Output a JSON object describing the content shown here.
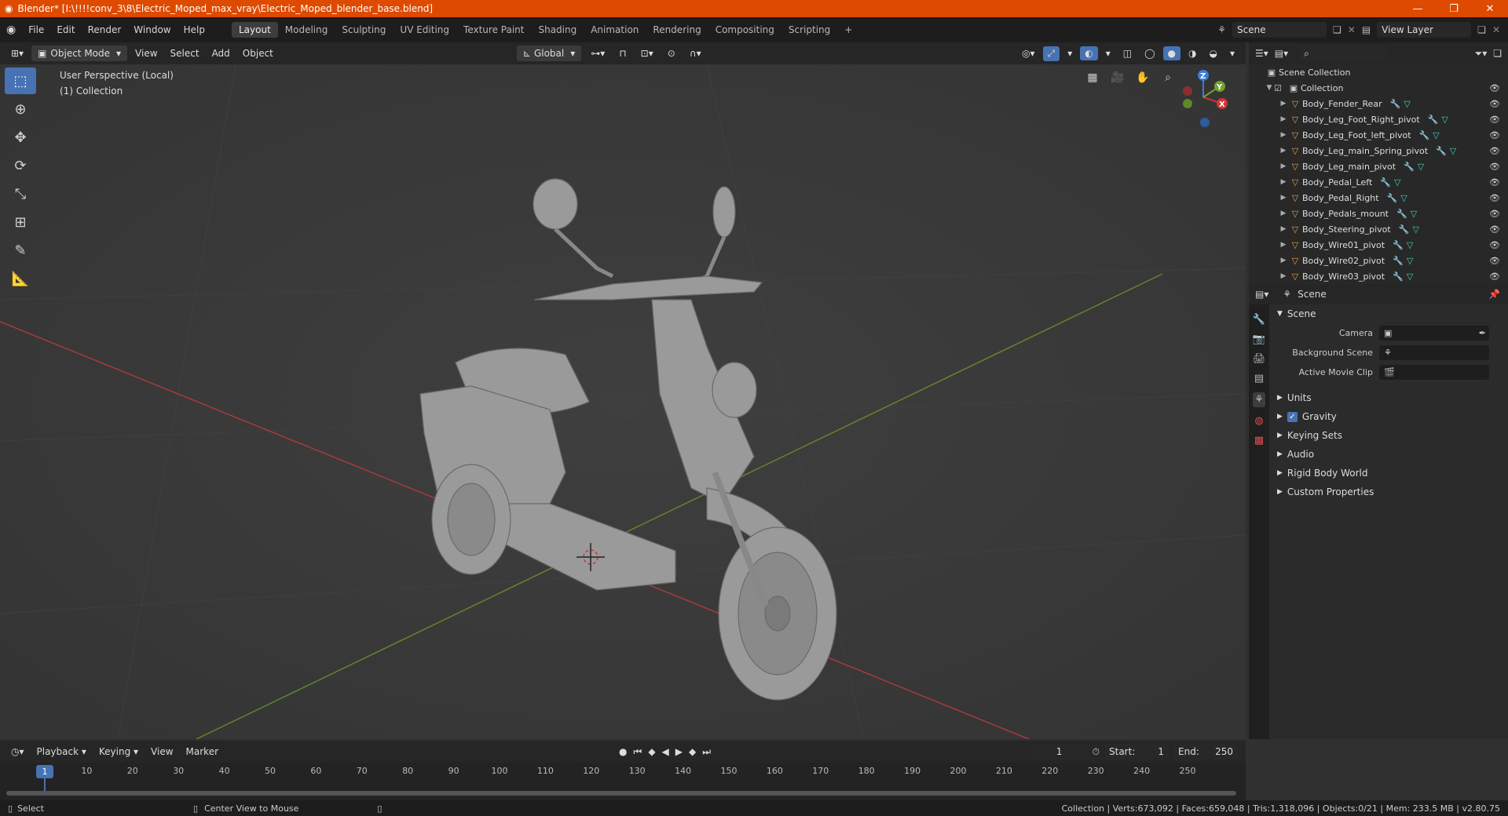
{
  "window": {
    "title": "Blender* [I:\\!!!!conv_3\\8\\Electric_Moped_max_vray\\Electric_Moped_blender_base.blend]",
    "controls": [
      "—",
      "❐",
      "✕"
    ]
  },
  "menu": [
    "File",
    "Edit",
    "Render",
    "Window",
    "Help"
  ],
  "workspaces": [
    {
      "label": "Layout",
      "active": true
    },
    {
      "label": "Modeling"
    },
    {
      "label": "Sculpting"
    },
    {
      "label": "UV Editing"
    },
    {
      "label": "Texture Paint"
    },
    {
      "label": "Shading"
    },
    {
      "label": "Animation"
    },
    {
      "label": "Rendering"
    },
    {
      "label": "Compositing"
    },
    {
      "label": "Scripting"
    }
  ],
  "scene_field": "Scene",
  "view_layer_field": "View Layer",
  "viewport_header": {
    "mode": "Object Mode",
    "menus": [
      "View",
      "Select",
      "Add",
      "Object"
    ],
    "orientation": "Global"
  },
  "viewport": {
    "perspective": "User Perspective (Local)",
    "collection": "(1) Collection"
  },
  "outliner": {
    "root": "Scene Collection",
    "collection": "Collection",
    "items": [
      "Body_Fender_Rear",
      "Body_Leg_Foot_Right_pivot",
      "Body_Leg_Foot_left_pivot",
      "Body_Leg_main_Spring_pivot",
      "Body_Leg_main_pivot",
      "Body_Pedal_Left",
      "Body_Pedal_Right",
      "Body_Pedals_mount",
      "Body_Steering_pivot",
      "Body_Wire01_pivot",
      "Body_Wire02_pivot",
      "Body_Wire03_pivot"
    ]
  },
  "properties": {
    "context": "Scene",
    "panel": "Scene",
    "camera_label": "Camera",
    "background_scene_label": "Background Scene",
    "active_movie_clip_label": "Active Movie Clip",
    "sections": [
      "Units",
      "Gravity",
      "Keying Sets",
      "Audio",
      "Rigid Body World",
      "Custom Properties"
    ]
  },
  "timeline": {
    "menus": [
      "Playback",
      "Keying",
      "View",
      "Marker"
    ],
    "current_frame": "1",
    "start_label": "Start:",
    "start": "1",
    "end_label": "End:",
    "end": "250",
    "ticks": [
      "1",
      "10",
      "20",
      "30",
      "40",
      "50",
      "60",
      "70",
      "80",
      "90",
      "100",
      "110",
      "120",
      "130",
      "140",
      "150",
      "160",
      "170",
      "180",
      "190",
      "200",
      "210",
      "220",
      "230",
      "240",
      "250"
    ]
  },
  "status": {
    "left": "Select",
    "middle": "Center View to Mouse",
    "right": "Collection | Verts:673,092 | Faces:659,048 | Tris:1,318,096 | Objects:0/21 | Mem: 233.5 MB | v2.80.75"
  },
  "colors": {
    "titlebar": "#de4a00",
    "x_axis": "#c83232",
    "y_axis": "#6e9a22",
    "active": "#4772b3"
  }
}
